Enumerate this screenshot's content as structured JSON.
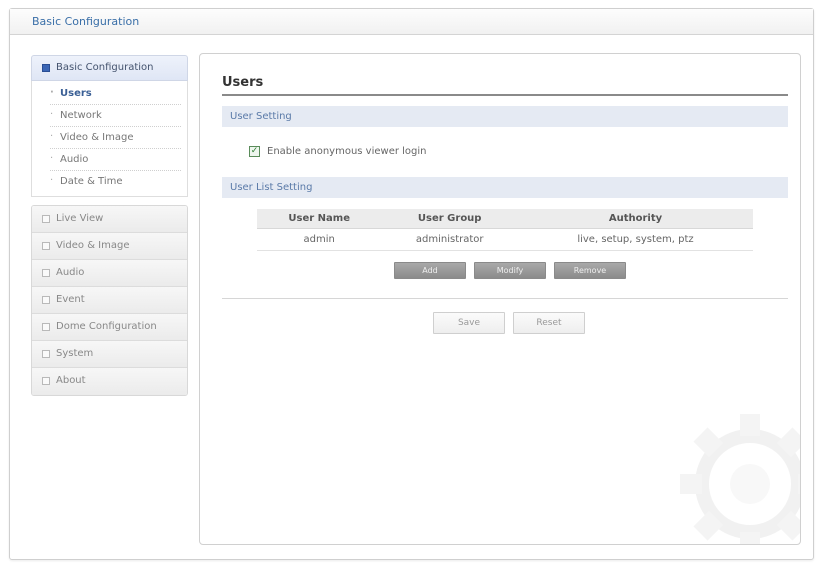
{
  "window": {
    "title": "Basic Configuration"
  },
  "sidebar": {
    "group": {
      "label": "Basic Configuration",
      "items": [
        {
          "label": "Users",
          "active": true
        },
        {
          "label": "Network"
        },
        {
          "label": "Video & Image"
        },
        {
          "label": "Audio"
        },
        {
          "label": "Date & Time"
        }
      ]
    },
    "menu": [
      {
        "label": "Live View"
      },
      {
        "label": "Video & Image"
      },
      {
        "label": "Audio"
      },
      {
        "label": "Event"
      },
      {
        "label": "Dome Configuration"
      },
      {
        "label": "System"
      },
      {
        "label": "About"
      }
    ]
  },
  "main": {
    "title": "Users",
    "user_setting": {
      "label": "User Setting",
      "anonymous_login": {
        "label": "Enable anonymous viewer login",
        "checked": true
      }
    },
    "user_list": {
      "label": "User List Setting",
      "columns": [
        "User Name",
        "User Group",
        "Authority"
      ],
      "rows": [
        [
          "admin",
          "administrator",
          "live, setup, system, ptz"
        ]
      ],
      "buttons": {
        "add": "Add",
        "modify": "Modify",
        "remove": "Remove"
      }
    },
    "buttons": {
      "save": "Save",
      "reset": "Reset"
    }
  },
  "icons": {
    "watermark": "gear-icon"
  },
  "colors": {
    "accent": "#3a6fa8",
    "section_bar": "#e5eaf3",
    "active_group_icon": "#3b66b5"
  }
}
